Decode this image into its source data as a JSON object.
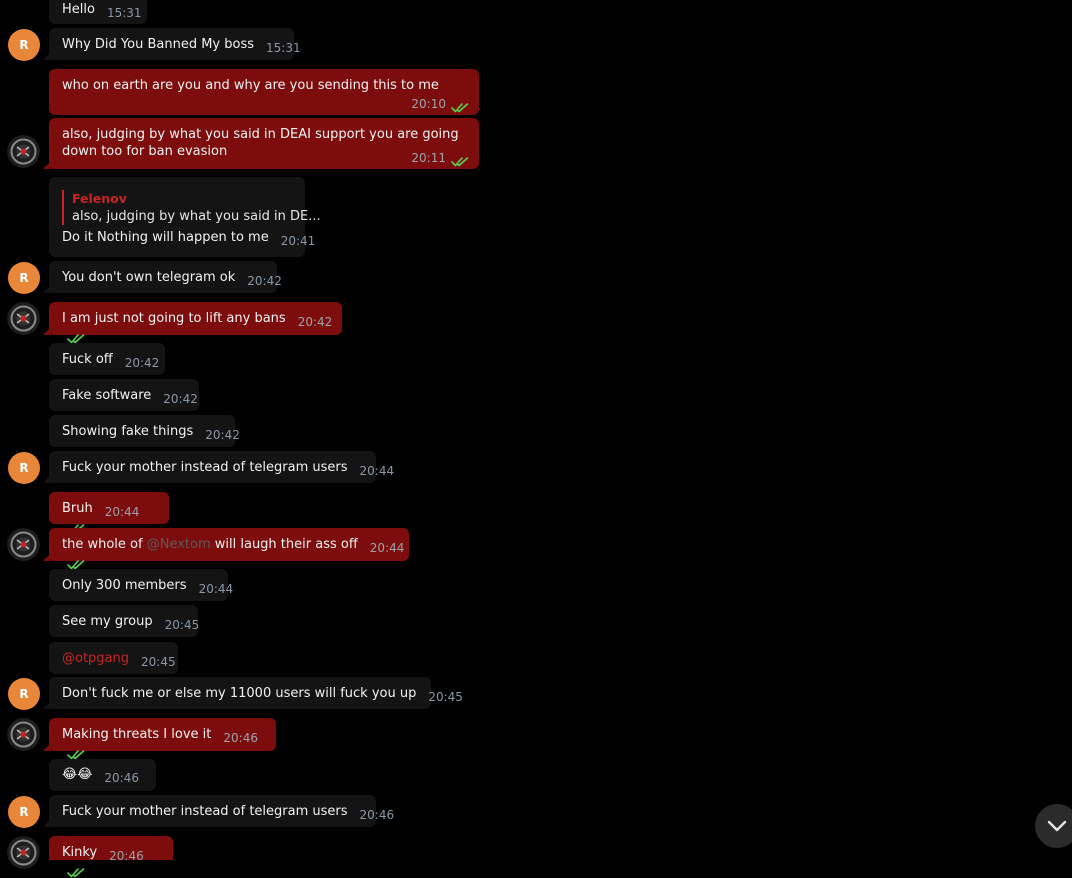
{
  "avatar_letter": "R",
  "colors": {
    "outgoing_bubble": "#7d0d0d",
    "incoming_bubble": "#141414",
    "background": "#000000",
    "avatar_r": "#e8873a",
    "link": "#c92424",
    "read_ticks": "#5ad14e"
  },
  "messages": [
    {
      "text": "Hello",
      "time": "15:31"
    },
    {
      "text": "Why Did You Banned My boss",
      "time": "15:31"
    },
    {
      "text": "who on earth are you and why are you sending this to me",
      "time": "20:10"
    },
    {
      "text": "also, judging by what you said in DEAI support you are going down too for ban evasion",
      "time": "20:11"
    },
    {
      "reply_name": "Felenov",
      "reply_text": "also, judging by what you said in DE...",
      "text": "Do it Nothing will happen to me",
      "time": "20:41"
    },
    {
      "text": "You don't own telegram ok",
      "time": "20:42"
    },
    {
      "text": "I am just not going to lift any bans",
      "time": "20:42"
    },
    {
      "text": "Fuck off",
      "time": "20:42"
    },
    {
      "text": "Fake software",
      "time": "20:42"
    },
    {
      "text": "Showing fake things",
      "time": "20:42"
    },
    {
      "text": "Fuck your mother instead of telegram users",
      "time": "20:44"
    },
    {
      "text": "Bruh",
      "time": "20:44"
    },
    {
      "text_before": "the whole of",
      "mention": "@Nextom",
      "text_after": "will laugh their ass off",
      "time": "20:44"
    },
    {
      "text": "Only 300 members",
      "time": "20:44"
    },
    {
      "text": "See my group",
      "time": "20:45"
    },
    {
      "text": "@otpgang",
      "time": "20:45"
    },
    {
      "text": "Don't fuck me or else my 11000 users will fuck you up",
      "time": "20:45"
    },
    {
      "text": "Making threats I love it",
      "time": "20:46"
    },
    {
      "text": "😂😂",
      "time": "20:46"
    },
    {
      "text": "Fuck your mother instead of telegram users",
      "time": "20:46"
    },
    {
      "text": "Kinky",
      "time": "20:46"
    }
  ],
  "icons": {
    "scroll_down": "chevron-down-icon",
    "read": "double-check-icon"
  }
}
